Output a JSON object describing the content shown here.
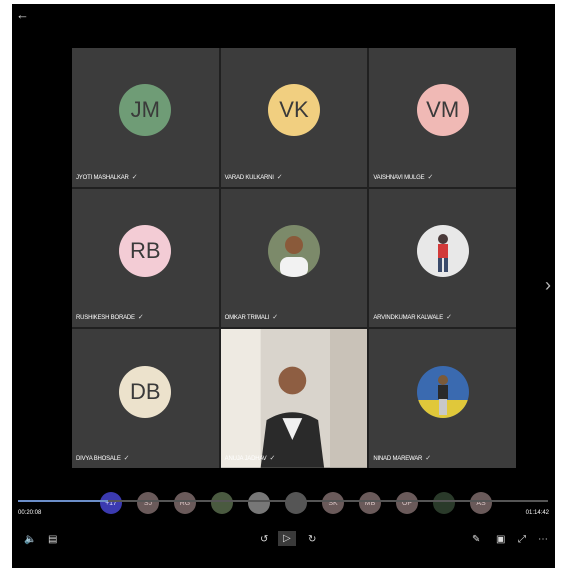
{
  "tiles": [
    {
      "initials": "JM",
      "name": "JYOTI MASHALKAR",
      "color": "#6f9c76"
    },
    {
      "initials": "VK",
      "name": "VARAD KULKARNI",
      "color": "#f1cf80"
    },
    {
      "initials": "VM",
      "name": "VAISHNAVI MULGE",
      "color": "#f0b9b5"
    },
    {
      "initials": "RB",
      "name": "RUSHIKESH BORADE",
      "color": "#f3ccd5"
    },
    {
      "initials": "",
      "name": "OMKAR TRIMALI",
      "color": ""
    },
    {
      "initials": "",
      "name": "ARVINDKUMAR KALWALE",
      "color": ""
    },
    {
      "initials": "DB",
      "name": "DIVYA BHOSALE",
      "color": "#ece2cc"
    },
    {
      "initials": "",
      "name": "ANUJA JADHAV",
      "color": ""
    },
    {
      "initials": "",
      "name": "NINAD MAREWAR",
      "color": ""
    }
  ],
  "strip": {
    "more": "+17",
    "items": [
      "SJ",
      "RG",
      "",
      "",
      "",
      "SK",
      "MB",
      "OP",
      "",
      "AS"
    ]
  },
  "playback": {
    "elapsed": "00:20:08",
    "total": "01:14:42",
    "progress_fraction": 0.17
  },
  "icons": {
    "back": "arrow-left-icon",
    "next": "chevron-right-icon",
    "volume": "volume-icon",
    "captions": "captions-icon",
    "rewind": "rewind-10-icon",
    "play": "play-icon",
    "forward": "forward-30-icon",
    "pen": "pen-icon",
    "miniplayer": "miniplayer-icon",
    "fullscreen": "fullscreen-icon",
    "more": "more-icon"
  }
}
